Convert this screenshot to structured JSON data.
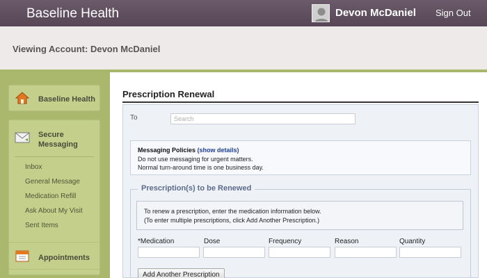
{
  "header": {
    "app_title": "Baseline Health",
    "user_name": "Devon McDaniel",
    "sign_out": "Sign Out"
  },
  "account": {
    "viewing_label": "Viewing Account: Devon McDaniel"
  },
  "sidebar": {
    "home_label": "Baseline Health",
    "messaging": {
      "label_line1": "Secure",
      "label_line2": "Messaging",
      "links": [
        "Inbox",
        "General Message",
        "Medication Refill",
        "Ask About My Visit",
        "Sent Items"
      ]
    },
    "appointments_label": "Appointments"
  },
  "main": {
    "page_title": "Prescription Renewal",
    "to_label": "To",
    "to_placeholder": "Search",
    "policies": {
      "title": "Messaging Policies",
      "link": "(show details)",
      "line1": "Do not use messaging for urgent matters.",
      "line2": "Normal turn-around time is one business day."
    },
    "section": {
      "legend": "Prescription(s) to be Renewed",
      "instr_line1": "To renew a prescription, enter the medication information below.",
      "instr_line2": "(To enter multiple prescriptions, click Add Another Prescription.)",
      "columns": [
        "*Medication",
        "Dose",
        "Frequency",
        "Reason",
        "Quantity"
      ],
      "add_button": "Add Another Prescription"
    }
  },
  "colors": {
    "topbar": "#5f4f5f",
    "sidebar": "#a9b86d",
    "link": "#1a3ea3"
  }
}
